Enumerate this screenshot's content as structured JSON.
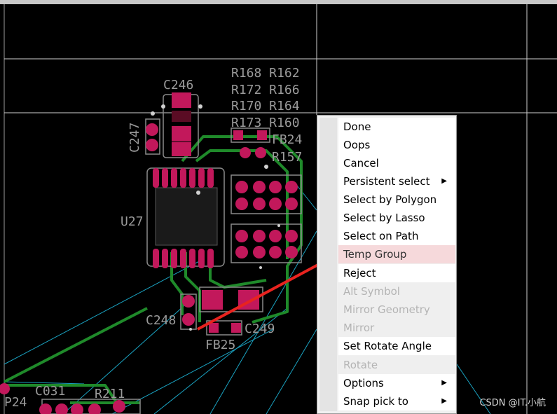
{
  "pcb": {
    "labels": {
      "c246": "C246",
      "c247": "C247",
      "u27": "U27",
      "c248": "C248",
      "c249": "C249",
      "fb24": "FB24",
      "fb25": "FB25",
      "r157": "R157",
      "r211": "R211",
      "p24": "P24",
      "c031": "C031",
      "r168_r162": "R168 R162",
      "r172_r166": "R172 R166",
      "r170_r164": "R170 R164",
      "r173_r160": "R173 R160"
    }
  },
  "context_menu": {
    "items": [
      {
        "label": "Done",
        "state": "enabled"
      },
      {
        "label": "Oops",
        "state": "enabled"
      },
      {
        "label": "Cancel",
        "state": "enabled"
      },
      {
        "label": "Persistent select",
        "state": "enabled",
        "submenu": true
      },
      {
        "label": "Select by Polygon",
        "state": "enabled"
      },
      {
        "label": "Select by Lasso",
        "state": "enabled"
      },
      {
        "label": "Select on Path",
        "state": "enabled"
      },
      {
        "label": "Temp Group",
        "state": "highlighted"
      },
      {
        "label": "Reject",
        "state": "enabled"
      },
      {
        "label": "Alt Symbol",
        "state": "disabled"
      },
      {
        "label": "Mirror Geometry",
        "state": "disabled"
      },
      {
        "label": "Mirror",
        "state": "disabled"
      },
      {
        "label": "Set Rotate Angle",
        "state": "enabled"
      },
      {
        "label": "Rotate",
        "state": "disabled"
      },
      {
        "label": "Options",
        "state": "enabled",
        "submenu": true
      },
      {
        "label": "Snap pick to",
        "state": "enabled",
        "submenu": true
      }
    ]
  },
  "watermark": "CSDN @IT.小航",
  "colors": {
    "background": "#000000",
    "pad": "#c2185b",
    "trace": "#1f8a2a",
    "ratsnest": "#1aa3c2",
    "silkscreen": "#9a9a9a",
    "annotation_arrow": "#e8231f"
  },
  "icons": {
    "submenu": "submenu-arrow-icon"
  }
}
